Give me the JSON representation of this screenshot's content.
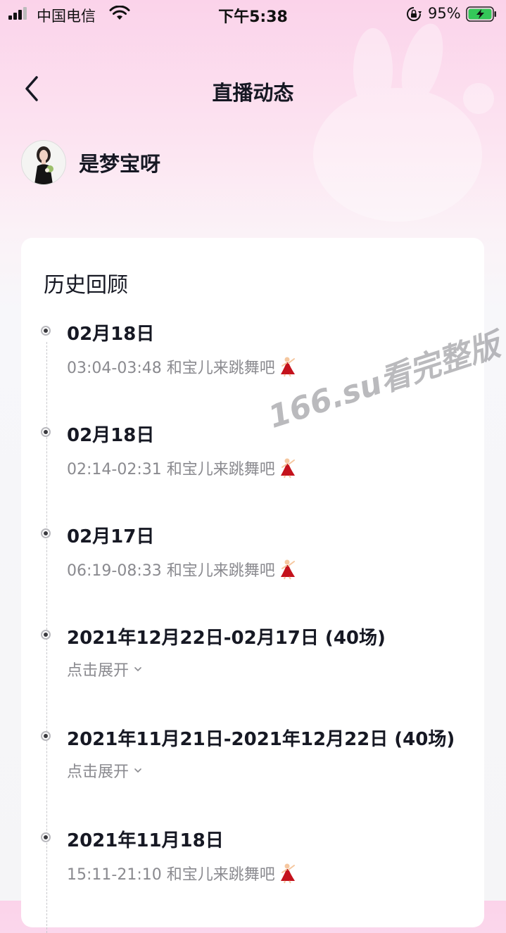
{
  "status_bar": {
    "carrier": "中国电信",
    "time": "下午5:38",
    "battery_percent": "95%"
  },
  "header": {
    "title": "直播动态",
    "back_icon": "chevron-left-icon"
  },
  "profile": {
    "name": "是梦宝呀"
  },
  "history": {
    "title": "历史回顾",
    "entries": [
      {
        "date": "02月18日",
        "detail": "03:04-03:48 和宝儿来跳舞吧",
        "type": "session"
      },
      {
        "date": "02月18日",
        "detail": "02:14-02:31 和宝儿来跳舞吧",
        "type": "session"
      },
      {
        "date": "02月17日",
        "detail": "06:19-08:33 和宝儿来跳舞吧",
        "type": "session"
      },
      {
        "date": "2021年12月22日-02月17日 (40场)",
        "detail": "点击展开",
        "type": "group"
      },
      {
        "date": "2021年11月21日-2021年12月22日 (40场)",
        "detail": "点击展开",
        "type": "group"
      },
      {
        "date": "2021年11月18日",
        "detail": "15:11-21:10 和宝儿来跳舞吧",
        "type": "session"
      }
    ]
  },
  "watermark": "166.su看完整版",
  "colors": {
    "text_primary": "#161823",
    "text_secondary": "#8a8a8f",
    "header_gradient_top": "#fbd3ea"
  }
}
